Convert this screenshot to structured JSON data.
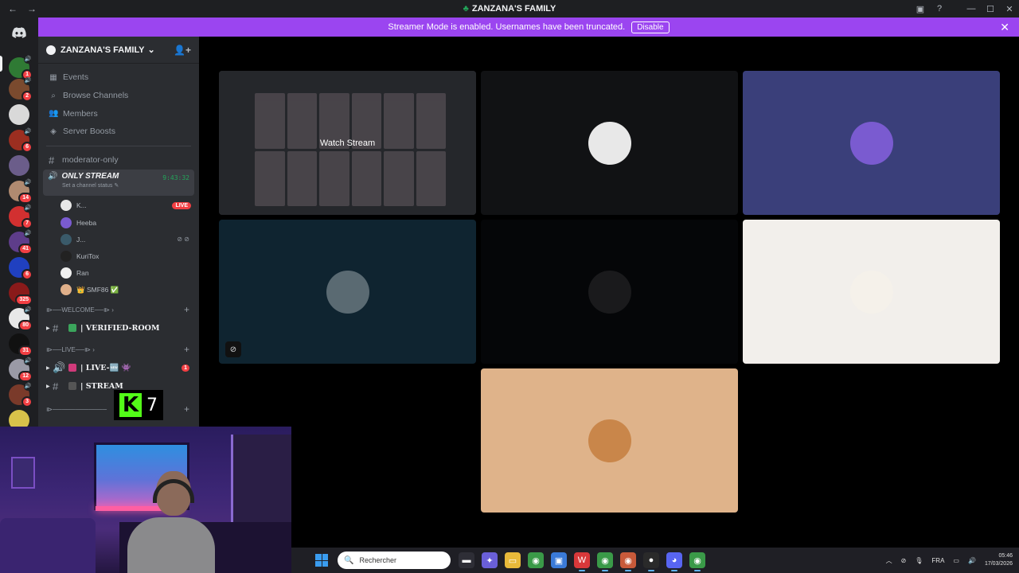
{
  "window": {
    "title": "ZANZANA'S FAMILY",
    "nav_back": "←",
    "nav_forward": "→",
    "controls": {
      "inbox": "▣",
      "help": "?",
      "minimize": "—",
      "maximize": "☐",
      "close": "✕"
    }
  },
  "banner": {
    "text": "Streamer Mode is enabled. Usernames have been truncated.",
    "button": "Disable",
    "close": "✕",
    "color": "#9b45f0"
  },
  "server_rail": {
    "items": [
      {
        "color": "#2f7a34",
        "badge": "1",
        "voice": true
      },
      {
        "color": "#7a4a2e",
        "badge": "2",
        "voice": true
      },
      {
        "color": "#d9d9d9",
        "badge": "",
        "voice": false
      },
      {
        "color": "#9c2e20",
        "badge": "6",
        "voice": true
      },
      {
        "color": "#6b5d8a",
        "badge": "",
        "voice": false
      },
      {
        "color": "#b08a70",
        "badge": "14",
        "voice": true
      },
      {
        "color": "#d23030",
        "badge": "7",
        "voice": true
      },
      {
        "color": "#5e3d8a",
        "badge": "41",
        "voice": true
      },
      {
        "color": "#2040c0",
        "badge": "6",
        "voice": false
      },
      {
        "color": "#8a1a1a",
        "badge": "325",
        "voice": false
      },
      {
        "color": "#e8e8e8",
        "badge": "80",
        "voice": true
      },
      {
        "color": "#111111",
        "badge": "31",
        "voice": false
      },
      {
        "color": "#9a9aa6",
        "badge": "12",
        "voice": true
      },
      {
        "color": "#7a3a2a",
        "badge": "3",
        "voice": true
      },
      {
        "color": "#d8c24a",
        "badge": "",
        "voice": false
      }
    ]
  },
  "sidebar": {
    "guild_name": "ZANZANA'S FAMILY",
    "guild_chevron": "⌄",
    "invite_icon": "👤+",
    "menu": [
      {
        "icon": "▦",
        "label": "Events"
      },
      {
        "icon": "⌕",
        "label": "Browse Channels"
      },
      {
        "icon": "👥",
        "label": "Members"
      },
      {
        "icon": "◈",
        "label": "Server Boosts"
      }
    ],
    "text_channel": "moderator-only",
    "voice_channel": {
      "name": "ONLY STREAM",
      "timer": "9:43:32",
      "status": "Set a channel status ✎"
    },
    "voice_users": [
      {
        "name": "K...",
        "color": "#e8e8e8",
        "live": "LIVE",
        "icons": ""
      },
      {
        "name": "Heeba",
        "color": "#7a5bd0",
        "live": "",
        "icons": ""
      },
      {
        "name": "J...",
        "color": "#3a5a6a",
        "live": "",
        "icons": "⊘ ⊘"
      },
      {
        "name": "KuriTox",
        "color": "#222222",
        "live": "",
        "icons": ""
      },
      {
        "name": "Ran",
        "color": "#f0f0f0",
        "live": "",
        "icons": ""
      },
      {
        "name": "👑 SMF86 ✅",
        "color": "#e0b08a",
        "live": "",
        "icons": ""
      }
    ],
    "categories": [
      {
        "label": "⧐──WELCOME──⧐  ›",
        "plus": "+"
      },
      {
        "label": "⧐──LIVE──⧐  ›",
        "plus": "+"
      },
      {
        "label": "⧐────────────",
        "plus": "+"
      }
    ],
    "channels_bold": [
      {
        "arrow": "▶",
        "hash": "#",
        "emo_color": "#3ba55c",
        "label": "| VERIFIED-ROOM",
        "badge": ""
      },
      {
        "arrow": "▶",
        "hash": "🔊",
        "emo_color": "#d03a7a",
        "label": "| LIVE-🆕 👾",
        "badge": "1"
      },
      {
        "arrow": "▶",
        "hash": "#",
        "emo_color": "#555555",
        "label": "| STREAM",
        "badge": ""
      }
    ]
  },
  "overlay": {
    "k_letter": "K",
    "number": "7"
  },
  "stage": {
    "watch_label": "Watch Stream",
    "tiles": [
      {
        "type": "stream",
        "bg": "#25272b"
      },
      {
        "type": "avatar",
        "bg": "#111214",
        "avatar": "#e8e8e8"
      },
      {
        "type": "avatar",
        "bg": "#3a3f7a",
        "avatar": "#7a5bd0"
      },
      {
        "type": "avatar",
        "bg": "#0f2430",
        "avatar": "#5a6a72",
        "muted": true
      },
      {
        "type": "avatar",
        "bg": "#050608",
        "avatar": "#1a1a1c"
      },
      {
        "type": "avatar",
        "bg": "#f2efeb",
        "avatar": "#f5f1ea"
      },
      {
        "type": "avatar",
        "bg": "#dfb38a",
        "avatar": "#c9864a"
      }
    ],
    "mute_icon": "⊘"
  },
  "taskbar": {
    "search_placeholder": "Rechercher",
    "search_icon": "🔍",
    "apps": [
      {
        "name": "task-view",
        "glyph": "▬",
        "color": "#2e2e36"
      },
      {
        "name": "copilot",
        "glyph": "✦",
        "color": "#6a5fd8"
      },
      {
        "name": "explorer",
        "glyph": "▭",
        "color": "#e8b93a"
      },
      {
        "name": "chrome",
        "glyph": "◉",
        "color": "#3a9a48"
      },
      {
        "name": "store",
        "glyph": "▣",
        "color": "#3a7ad8"
      },
      {
        "name": "wps",
        "glyph": "W",
        "color": "#d8383a"
      },
      {
        "name": "chrome-2",
        "glyph": "◉",
        "color": "#3a9a48"
      },
      {
        "name": "chrome-3",
        "glyph": "◉",
        "color": "#c85a3a"
      },
      {
        "name": "obs",
        "glyph": "●",
        "color": "#2a2a2a"
      },
      {
        "name": "discord",
        "glyph": "◕",
        "color": "#5865f2"
      },
      {
        "name": "chrome-4",
        "glyph": "◉",
        "color": "#3a9a48"
      }
    ],
    "tray": {
      "chevron": "︿",
      "net": "⊘",
      "mic": "🎙",
      "lang": "FRA",
      "monitor": "▭",
      "volume": "🔊"
    },
    "time": "05:46",
    "date": "17/03/2026"
  }
}
